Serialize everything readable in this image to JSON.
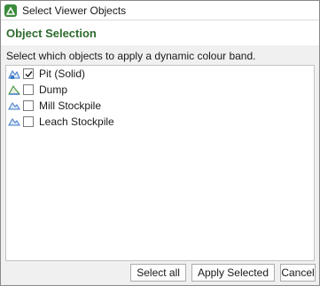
{
  "window": {
    "title": "Select Viewer Objects"
  },
  "header": {
    "title": "Object Selection"
  },
  "instructions": "Select which objects to apply a dynamic colour band.",
  "items": [
    {
      "label": "Pit (Solid)",
      "checked": true,
      "icon": "pit-solid-icon"
    },
    {
      "label": "Dump",
      "checked": false,
      "icon": "dump-icon"
    },
    {
      "label": "Mill Stockpile",
      "checked": false,
      "icon": "stockpile-icon"
    },
    {
      "label": "Leach Stockpile",
      "checked": false,
      "icon": "stockpile-icon"
    }
  ],
  "buttons": {
    "select_all": "Select all",
    "apply_selected": "Apply Selected",
    "cancel": "Cancel"
  },
  "colors": {
    "accent": "#2e6b2e",
    "app_icon": "#3a8a3a",
    "object_icon": "#3c78c8"
  }
}
